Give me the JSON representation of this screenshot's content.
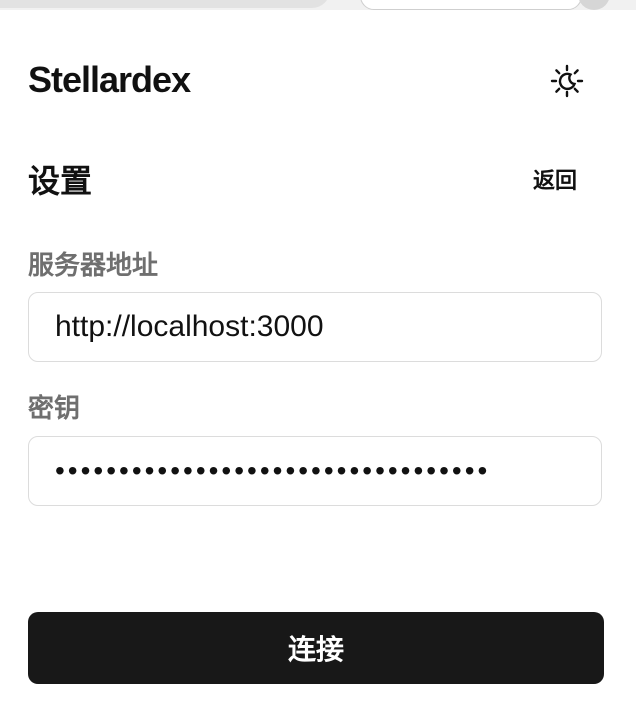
{
  "app": {
    "brand": "Stellardex",
    "theme_toggle_icon": "sun-moon-icon"
  },
  "settings": {
    "title": "设置",
    "back_label": "返回",
    "server": {
      "label": "服务器地址",
      "value": "http://localhost:3000"
    },
    "key": {
      "label": "密钥",
      "value": "••••••••••••••••••••••••••••••••••"
    },
    "connect_label": "连接"
  },
  "colors": {
    "primary_button": "#181818",
    "label_text": "#6f6f6f",
    "field_border": "#dcdcdc"
  }
}
